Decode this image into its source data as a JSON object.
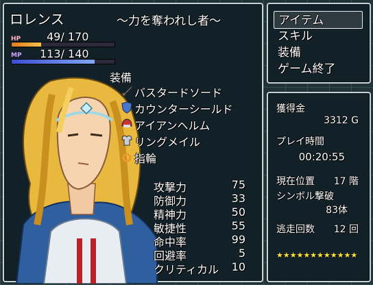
{
  "character": {
    "name": "ロレンス",
    "title": "～力を奪われし者～",
    "hp": {
      "tag": "HP",
      "current": "49",
      "max": "170",
      "fraction": 0.288
    },
    "mp": {
      "tag": "MP",
      "current": "113",
      "max": "140",
      "fraction": 0.807
    },
    "sep": "/"
  },
  "equipment": {
    "header": "装備",
    "items": [
      {
        "icon": "sword-icon",
        "label": "バスタードソード"
      },
      {
        "icon": "shield-icon",
        "label": "カウンターシールド"
      },
      {
        "icon": "helmet-icon",
        "label": "アイアンヘルム"
      },
      {
        "icon": "chainmail-icon",
        "label": "リングメイル"
      },
      {
        "icon": "ring-icon",
        "label": "指輪"
      }
    ]
  },
  "stats": [
    {
      "name": "攻撃力",
      "value": "75"
    },
    {
      "name": "防御力",
      "value": "33"
    },
    {
      "name": "精神力",
      "value": "50"
    },
    {
      "name": "敏捷性",
      "value": "55"
    },
    {
      "name": "命中率",
      "value": "99"
    },
    {
      "name": "回避率",
      "value": "5"
    },
    {
      "name": "クリティカル",
      "value": "10"
    }
  ],
  "menu": {
    "items": [
      "アイテム",
      "スキル",
      "装備",
      "ゲーム終了"
    ],
    "selected": 0
  },
  "info": {
    "gold_label": "獲得金",
    "gold_value": "3312 G",
    "time_label": "プレイ時間",
    "time_value": "00:20:55",
    "floor_label": "現在位置",
    "floor_value": "17 階",
    "symbol_label": "シンボル撃破",
    "symbol_value": "83体",
    "escape_label": "逃走回数",
    "escape_value": "12 回",
    "stars": "★★★★★★★★★★★★"
  },
  "colors": {
    "hp_gauge": "#e07a1f",
    "mp_gauge": "#3c4fd1",
    "stars": "#ffe23a",
    "window_border": "#c9d3da"
  }
}
